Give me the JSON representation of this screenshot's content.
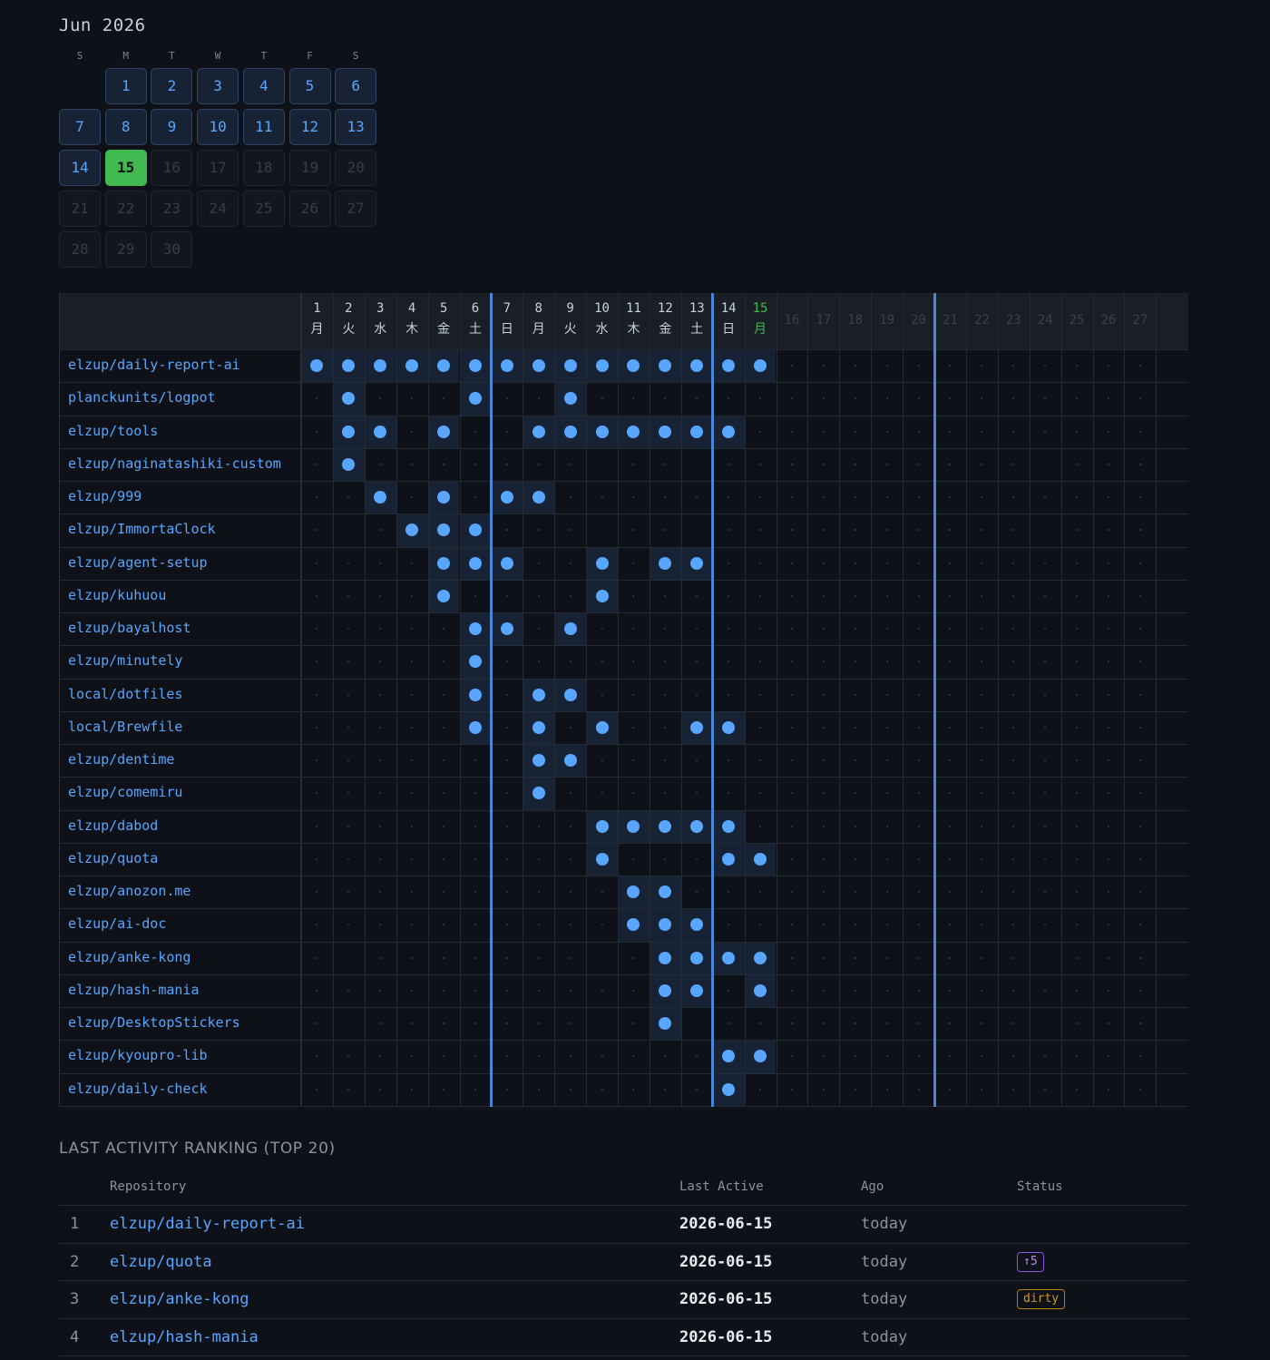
{
  "calendar": {
    "title": "Jun 2026",
    "weekdays": [
      "S",
      "M",
      "T",
      "W",
      "T",
      "F",
      "S"
    ],
    "first_weekday": 1,
    "days_in_month": 30,
    "today": 15,
    "active_days": [
      1,
      2,
      3,
      4,
      5,
      6,
      7,
      8,
      9,
      10,
      11,
      12,
      13,
      14
    ]
  },
  "grid": {
    "day_numbers": [
      "1",
      "2",
      "3",
      "4",
      "5",
      "6",
      "7",
      "8",
      "9",
      "10",
      "11",
      "12",
      "13",
      "14",
      "15",
      "16",
      "17",
      "18",
      "19",
      "20",
      "21",
      "22",
      "23",
      "24",
      "25",
      "26",
      "27"
    ],
    "weekday_labels": [
      "月",
      "火",
      "水",
      "木",
      "金",
      "土",
      "日",
      "月",
      "火",
      "水",
      "木",
      "金",
      "土",
      "日",
      "月"
    ],
    "today_index": 15,
    "repos": [
      {
        "name": "elzup/daily-report-ai",
        "days": [
          1,
          2,
          3,
          4,
          5,
          6,
          7,
          8,
          9,
          10,
          11,
          12,
          13,
          14,
          15
        ]
      },
      {
        "name": "planckunits/logpot",
        "days": [
          2,
          6,
          9
        ]
      },
      {
        "name": "elzup/tools",
        "days": [
          2,
          3,
          5,
          8,
          9,
          10,
          11,
          12,
          13,
          14
        ]
      },
      {
        "name": "elzup/naginatashiki-custom",
        "days": [
          2
        ]
      },
      {
        "name": "elzup/999",
        "days": [
          3,
          5,
          7,
          8
        ]
      },
      {
        "name": "elzup/ImmortaClock",
        "days": [
          4,
          5,
          6
        ]
      },
      {
        "name": "elzup/agent-setup",
        "days": [
          5,
          6,
          7,
          10,
          12,
          13
        ]
      },
      {
        "name": "elzup/kuhuou",
        "days": [
          5,
          10
        ]
      },
      {
        "name": "elzup/bayalhost",
        "days": [
          6,
          7,
          9
        ]
      },
      {
        "name": "elzup/minutely",
        "days": [
          6
        ]
      },
      {
        "name": "local/dotfiles",
        "days": [
          6,
          8,
          9
        ]
      },
      {
        "name": "local/Brewfile",
        "days": [
          6,
          8,
          10,
          13,
          14
        ]
      },
      {
        "name": "elzup/dentime",
        "days": [
          8,
          9
        ]
      },
      {
        "name": "elzup/comemiru",
        "days": [
          8
        ]
      },
      {
        "name": "elzup/dabod",
        "days": [
          10,
          11,
          12,
          13,
          14
        ]
      },
      {
        "name": "elzup/quota",
        "days": [
          10,
          14,
          15
        ]
      },
      {
        "name": "elzup/anozon.me",
        "days": [
          11,
          12
        ]
      },
      {
        "name": "elzup/ai-doc",
        "days": [
          11,
          12,
          13
        ]
      },
      {
        "name": "elzup/anke-kong",
        "days": [
          12,
          13,
          14,
          15
        ]
      },
      {
        "name": "elzup/hash-mania",
        "days": [
          12,
          13,
          15
        ]
      },
      {
        "name": "elzup/DesktopStickers",
        "days": [
          12
        ]
      },
      {
        "name": "elzup/kyoupro-lib",
        "days": [
          14,
          15
        ]
      },
      {
        "name": "elzup/daily-check",
        "days": [
          14
        ]
      }
    ]
  },
  "ranking": {
    "title": "LAST ACTIVITY RANKING (TOP 20)",
    "headers": {
      "repository": "Repository",
      "last_active": "Last Active",
      "ago": "Ago",
      "status": "Status"
    },
    "rows": [
      {
        "rank": "1",
        "repo": "elzup/daily-report-ai",
        "last_active": "2026-06-15",
        "ago": "today",
        "status": "",
        "status_kind": ""
      },
      {
        "rank": "2",
        "repo": "elzup/quota",
        "last_active": "2026-06-15",
        "ago": "today",
        "status": "↑5",
        "status_kind": "ahead"
      },
      {
        "rank": "3",
        "repo": "elzup/anke-kong",
        "last_active": "2026-06-15",
        "ago": "today",
        "status": "dirty",
        "status_kind": "dirty"
      },
      {
        "rank": "4",
        "repo": "elzup/hash-mania",
        "last_active": "2026-06-15",
        "ago": "today",
        "status": "",
        "status_kind": ""
      }
    ]
  },
  "colors": {
    "background": "#0e1117",
    "accent": "#58a6ff",
    "today": "#3fb950",
    "week_separator": "#4a86d8",
    "badge_ahead": "#bc8cff",
    "badge_dirty": "#d29922"
  }
}
